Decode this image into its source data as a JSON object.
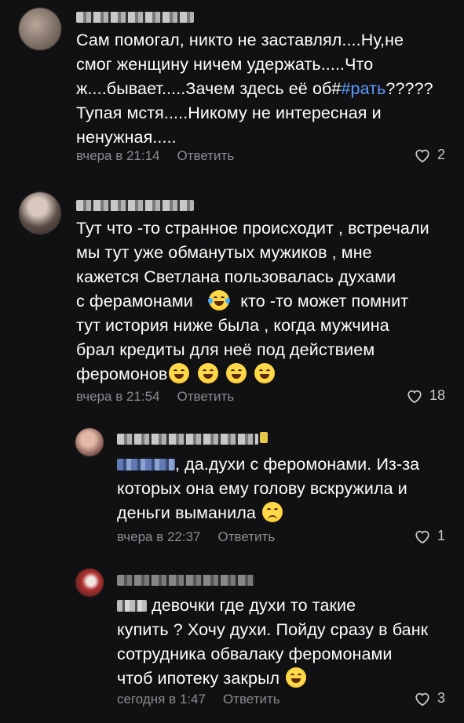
{
  "comments": [
    {
      "lines": [
        "Сам помогал, никто не заставлял....Ну,не",
        "смог женщину ничем удержать.....Что",
        "ж....бывает.....Зачем здесь её об#",
        "Тупая мстя.....Никому не интересная и",
        "ненужная....."
      ],
      "hashtag": "#рать",
      "after_hashtag": "?????",
      "time": "вчера в 21:14",
      "reply": "Ответить",
      "likes": "2"
    },
    {
      "lines": [
        "Тут что -то странное происходит , встречали",
        "мы тут уже обманутых мужиков , мне",
        "кажется Светлана пользовалась духами",
        "с ферамонами",
        "кто -то может помнит",
        "тут история ниже была , когда мужчина",
        "брал кредиты для неё под действием",
        "феромонов"
      ],
      "time": "вчера в 21:54",
      "reply": "Ответить",
      "likes": "18"
    },
    {
      "lines": [
        ", да.духи с феромонами. Из-за",
        "которых она ему голову вскружила и",
        "деньги выманила"
      ],
      "time": "вчера в 22:37",
      "reply": "Ответить",
      "likes": "1"
    },
    {
      "lines": [
        "девочки где духи то такие",
        "купить ? Хочу духи. Пойду сразу в банк",
        "сотрудника обвалаку феромонами",
        "чтоб ипотеку закрыл"
      ],
      "time": "сегодня в 1:47",
      "reply": "Ответить",
      "likes": "3"
    }
  ],
  "colors": {
    "background": "#111113",
    "text": "#ffffff",
    "meta": "#8b8b90",
    "hashtag": "#5b9bff"
  },
  "icons": {
    "like": "heart-outline-icon",
    "emoji_laugh": "rolling-on-floor-laughing-emoji",
    "emoji_joy": "face-with-tears-of-joy-emoji",
    "emoji_sad": "persevering-face-emoji"
  }
}
